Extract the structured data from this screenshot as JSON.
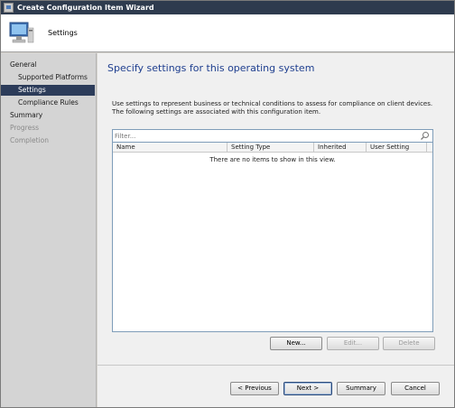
{
  "window": {
    "title": "Create Configuration Item Wizard"
  },
  "header": {
    "title": "Settings",
    "icon": "computer-monitor-icon"
  },
  "nav": {
    "items": [
      {
        "label": "General",
        "state": "normal"
      },
      {
        "label": "Supported Platforms",
        "state": "normal"
      },
      {
        "label": "Settings",
        "state": "selected"
      },
      {
        "label": "Compliance Rules",
        "state": "normal"
      },
      {
        "label": "Summary",
        "state": "normal"
      },
      {
        "label": "Progress",
        "state": "disabled"
      },
      {
        "label": "Completion",
        "state": "disabled"
      }
    ]
  },
  "main": {
    "heading": "Specify settings for this operating system",
    "description": "Use settings to represent business or technical conditions to assess for compliance on client devices. The following settings are associated with this configuration item.",
    "filter": {
      "placeholder": "Filter...",
      "value": ""
    },
    "list": {
      "columns": [
        "Name",
        "Setting Type",
        "Inherited",
        "User Setting"
      ],
      "empty_message": "There are no items to show in this view."
    },
    "list_buttons": {
      "new": "New...",
      "edit": "Edit...",
      "delete": "Delete"
    }
  },
  "footer": {
    "previous": "< Previous",
    "next": "Next >",
    "summary": "Summary",
    "cancel": "Cancel"
  },
  "colors": {
    "titlebar": "#2e3b4e",
    "nav_selected": "#2c3c5a",
    "heading": "#1f3f8f"
  }
}
